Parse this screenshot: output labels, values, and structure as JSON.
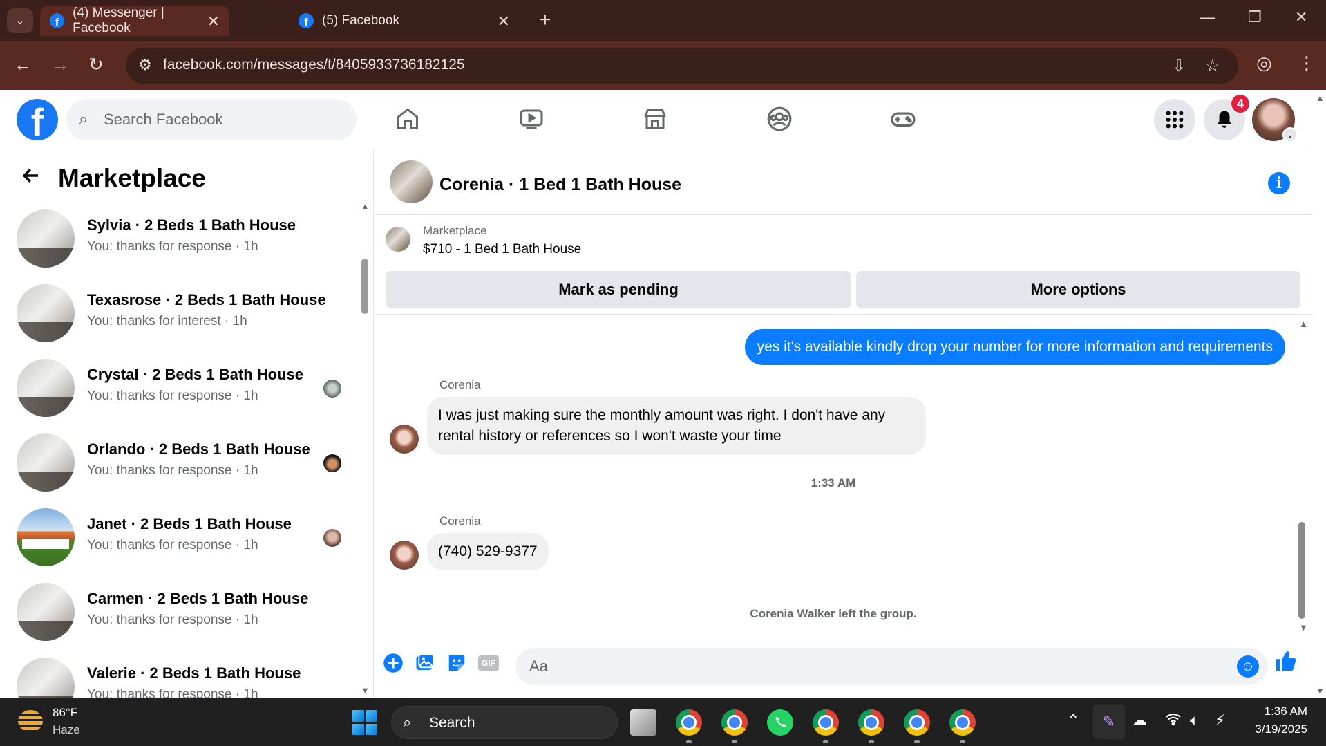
{
  "browser": {
    "tabs": [
      {
        "title": "(4) Messenger | Facebook",
        "active": true
      },
      {
        "title": "(5) Facebook",
        "active": false
      }
    ],
    "url": "facebook.com/messages/t/8405933736182125"
  },
  "header": {
    "search_placeholder": "Search Facebook",
    "notification_count": "4",
    "brand_color": "#1877f2"
  },
  "sidebar": {
    "title": "Marketplace",
    "chats": [
      {
        "name": "Sylvia · 2 Beds 1 Bath House",
        "preview": "You: thanks for response · 1h"
      },
      {
        "name": "Texasrose · 2 Beds 1 Bath House",
        "preview": "You: thanks for interest · 1h"
      },
      {
        "name": "Crystal · 2 Beds 1 Bath House",
        "preview": "You: thanks for response · 1h"
      },
      {
        "name": "Orlando · 2 Beds 1 Bath House",
        "preview": "You: thanks for response · 1h"
      },
      {
        "name": "Janet · 2 Beds 1 Bath House",
        "preview": "You: thanks for response · 1h"
      },
      {
        "name": "Carmen · 2 Beds 1 Bath House",
        "preview": "You: thanks for response · 1h"
      },
      {
        "name": "Valerie · 2 Beds 1 Bath House",
        "preview": "You: thanks for response · 1h"
      }
    ]
  },
  "conversation": {
    "title": "Corenia · 1 Bed 1 Bath House",
    "marketplace_label": "Marketplace",
    "listing": "$710 - 1 Bed 1 Bath House",
    "mark_pending_label": "Mark as pending",
    "more_options_label": "More options",
    "messages": [
      {
        "from": "me",
        "text": "yes it's available kindly drop your number for more information and requirements"
      },
      {
        "from": "Corenia",
        "text": "I was just making sure the monthly amount was right. I don't have any rental history or references so I won't waste your time"
      },
      {
        "from": "Corenia",
        "text": "(740) 529-9377"
      }
    ],
    "timestamp": "1:33 AM",
    "system_message": "Corenia Walker left the group.",
    "composer_placeholder": "Aa",
    "gif_label": "GIF",
    "accent_color": "#0a7cff"
  },
  "taskbar": {
    "temperature": "86°F",
    "weather": "Haze",
    "search_label": "Search",
    "time": "1:36 AM",
    "date": "3/19/2025"
  }
}
